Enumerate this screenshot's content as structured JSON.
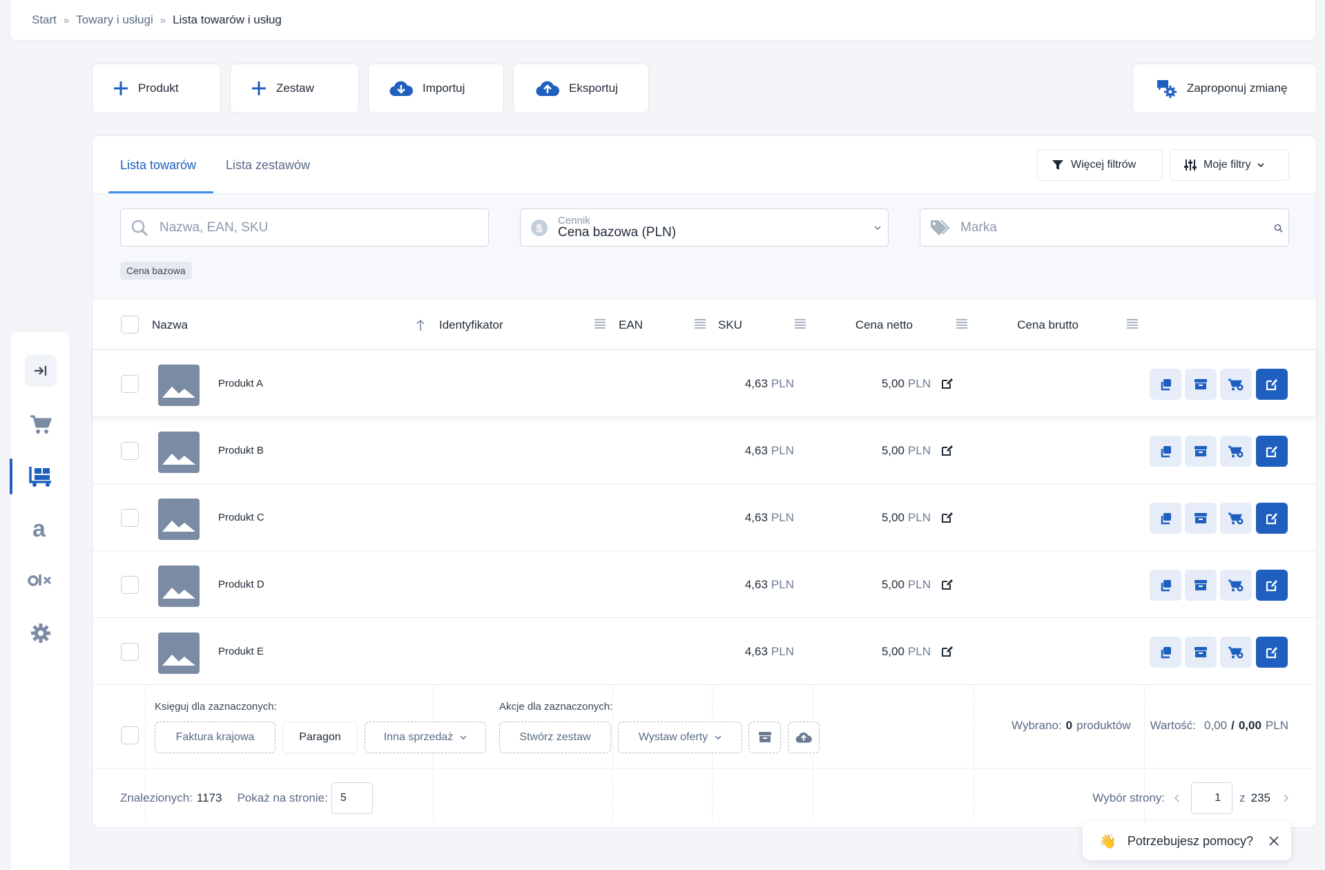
{
  "breadcrumb": {
    "items": [
      "Start",
      "Towary i usługi",
      "Lista towarów i usług"
    ],
    "separator": "»"
  },
  "actions": {
    "product": "Produkt",
    "set": "Zestaw",
    "import": "Importuj",
    "export": "Eksportuj",
    "propose": "Zaproponuj zmianę"
  },
  "tabs": {
    "goods": "Lista towarów",
    "sets": "Lista zestawów"
  },
  "filters": {
    "more": "Więcej filtrów",
    "mine": "Moje filtry"
  },
  "search": {
    "placeholder": "Nazwa, EAN, SKU"
  },
  "pricelist": {
    "label": "Cennik",
    "value": "Cena bazowa (PLN)"
  },
  "brand": {
    "placeholder": "Marka"
  },
  "active_badge": "Cena bazowa",
  "table": {
    "headers": {
      "name": "Nazwa",
      "identifier": "Identyfikator",
      "ean": "EAN",
      "sku": "SKU",
      "net": "Cena netto",
      "gross": "Cena brutto"
    },
    "currency": "PLN",
    "rows": [
      {
        "name": "Produkt A",
        "net": "4,63",
        "gross": "5,00"
      },
      {
        "name": "Produkt B",
        "net": "4,63",
        "gross": "5,00"
      },
      {
        "name": "Produkt C",
        "net": "4,63",
        "gross": "5,00"
      },
      {
        "name": "Produkt D",
        "net": "4,63",
        "gross": "5,00"
      },
      {
        "name": "Produkt E",
        "net": "4,63",
        "gross": "5,00"
      }
    ]
  },
  "bulk": {
    "book_label": "Księguj dla zaznaczonych:",
    "actions_label": "Akcje dla zaznaczonych:",
    "invoice": "Faktura krajowa",
    "receipt": "Paragon",
    "other_sale": "Inna sprzedaż",
    "create_set": "Stwórz zestaw",
    "offers": "Wystaw oferty",
    "selected_label": "Wybrano:",
    "selected_count": "0",
    "selected_unit": "produktów",
    "value_label": "Wartość:",
    "value_net": "0,00",
    "value_sep": "/",
    "value_gross": "0,00",
    "value_currency": "PLN"
  },
  "footer": {
    "found_label": "Znalezionych:",
    "found_count": "1173",
    "per_page_label": "Pokaż na stronie:",
    "per_page": "5",
    "page_label": "Wybór strony:",
    "page": "1",
    "of": "z",
    "pages": "235"
  },
  "help": {
    "emoji": "👋",
    "text": "Potrzebujesz pomocy?"
  },
  "colors": {
    "accent": "#1e5fbf",
    "accent_light": "#e6edf8",
    "tab_underline": "#3b8de8",
    "thumb": "#7b8ba3"
  },
  "icons": [
    "plus-icon",
    "cloud-download-icon",
    "cloud-upload-icon",
    "gear-chat-icon",
    "filter-icon",
    "sliders-icon",
    "search-icon",
    "dollar-icon",
    "tag-icon",
    "cart-icon",
    "warehouse-icon",
    "allegro-icon",
    "olx-icon",
    "settings-icon",
    "duplicate-icon",
    "archive-icon",
    "cart-add-icon",
    "edit-icon",
    "close-icon"
  ]
}
